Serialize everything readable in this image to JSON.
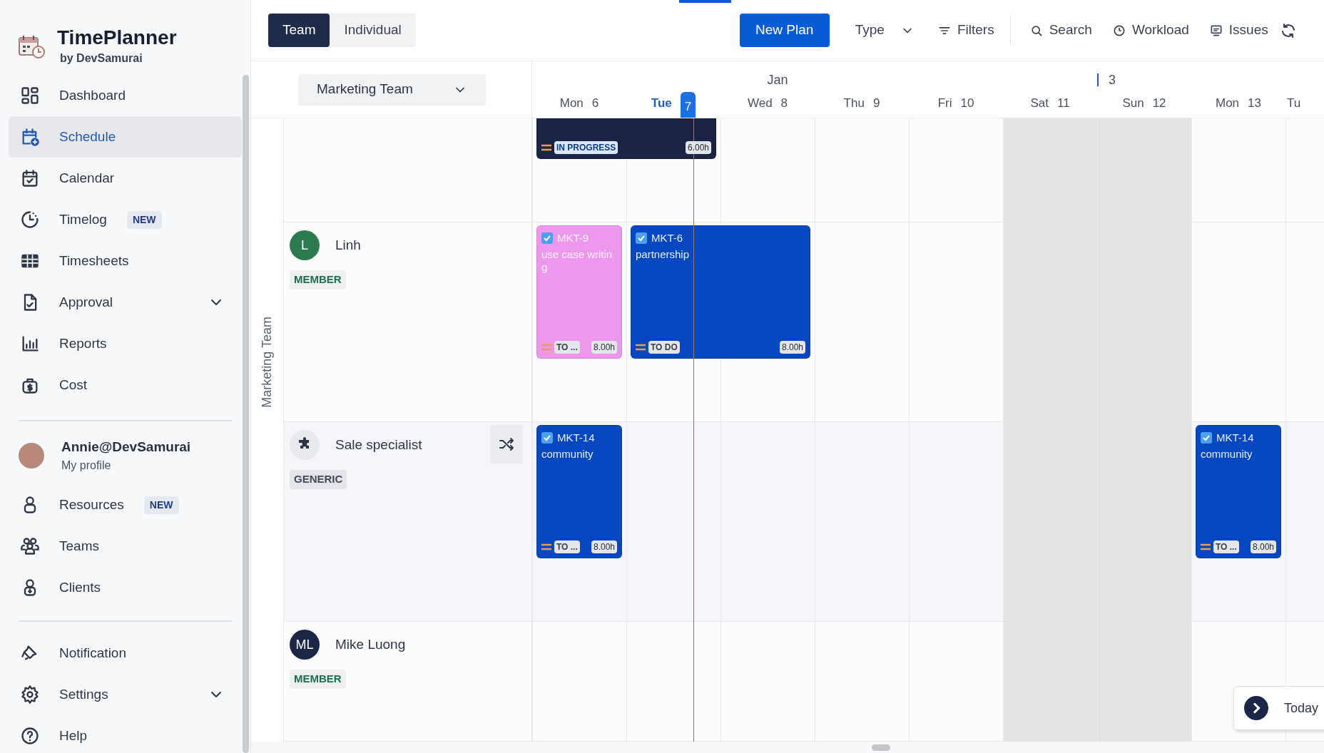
{
  "sidebar": {
    "brand": {
      "title": "TimePlanner",
      "subtitle": "by DevSamurai"
    },
    "nav": [
      {
        "label": "Dashboard",
        "selected": false,
        "kind": "link"
      },
      {
        "label": "Schedule",
        "selected": true,
        "kind": "link"
      },
      {
        "label": "Calendar",
        "selected": false,
        "kind": "link"
      },
      {
        "label": "Timelog",
        "selected": false,
        "kind": "link",
        "badge": "NEW"
      },
      {
        "label": "Timesheets",
        "selected": false,
        "kind": "link"
      },
      {
        "label": "Approval",
        "selected": false,
        "kind": "group"
      },
      {
        "label": "Reports",
        "selected": false,
        "kind": "link"
      },
      {
        "label": "Cost",
        "selected": false,
        "kind": "link"
      }
    ],
    "profile": {
      "name": "Annie@DevSamurai",
      "link": "My profile"
    },
    "people": [
      {
        "label": "Resources",
        "selected": false,
        "kind": "link",
        "badge": "NEW"
      },
      {
        "label": "Teams",
        "selected": false,
        "kind": "link"
      },
      {
        "label": "Clients",
        "selected": false,
        "kind": "link"
      }
    ],
    "footer": [
      {
        "label": "Notification",
        "selected": false,
        "kind": "link"
      },
      {
        "label": "Settings",
        "selected": false,
        "kind": "group"
      },
      {
        "label": "Help",
        "selected": false,
        "kind": "link"
      }
    ]
  },
  "toolbar": {
    "view_tabs": [
      {
        "label": "Team",
        "selected": true
      },
      {
        "label": "Individual",
        "selected": false
      }
    ],
    "new_button": "New Plan",
    "type_dropdown": "Type",
    "actions": [
      "Filters",
      "Search",
      "Workload",
      "Issues"
    ]
  },
  "schedule": {
    "team_select": "Marketing Team",
    "group_label": "Marketing Team",
    "month": "Jan",
    "week": "3",
    "days": [
      {
        "weekday": "Mon",
        "date": "6",
        "today": false,
        "weekend": false
      },
      {
        "weekday": "Tue",
        "date": "7",
        "today": true,
        "weekend": false
      },
      {
        "weekday": "Wed",
        "date": "8",
        "today": false,
        "weekend": false
      },
      {
        "weekday": "Thu",
        "date": "9",
        "today": false,
        "weekend": false
      },
      {
        "weekday": "Fri",
        "date": "10",
        "today": false,
        "weekend": false
      },
      {
        "weekday": "Sat",
        "date": "11",
        "today": false,
        "weekend": true
      },
      {
        "weekday": "Sun",
        "date": "12",
        "today": false,
        "weekend": true
      },
      {
        "weekday": "Mon",
        "date": "13",
        "today": false,
        "weekend": false
      },
      {
        "weekday": "Tu",
        "today": false,
        "weekend": false
      }
    ],
    "rows": [
      {
        "highlighted": false,
        "tasks": [
          {
            "status": "IN PROGRESS",
            "in_progress": true,
            "hours": "6.00h",
            "color": "#1b2444"
          }
        ]
      },
      {
        "highlighted": false,
        "member": {
          "kind": "member",
          "initials": "L",
          "name": "Linh",
          "role": "MEMBER",
          "color": "#2b7a50"
        },
        "tasks": [
          {
            "key": "MKT-9",
            "title": "use case writing",
            "status": "TO ...",
            "in_progress": false,
            "hours": "8.00h",
            "color": "#ee97ee"
          },
          {
            "key": "MKT-6",
            "title": "partnership",
            "status": "TO DO",
            "in_progress": false,
            "hours": "8.00h",
            "color": "#0747c2"
          }
        ]
      },
      {
        "highlighted": true,
        "member": {
          "kind": "generic",
          "name": "Sale specialist",
          "role": "GENERIC"
        },
        "tasks": [
          {
            "key": "MKT-14",
            "title": "community",
            "status": "TO ...",
            "in_progress": false,
            "hours": "8.00h",
            "color": "#0747c2"
          },
          {
            "key": "MKT-14",
            "title": "community",
            "status": "TO ...",
            "in_progress": false,
            "hours": "8.00h",
            "color": "#0747c2"
          }
        ]
      },
      {
        "highlighted": false,
        "member": {
          "kind": "member",
          "initials": "ML",
          "name": "Mike Luong",
          "role": "MEMBER",
          "color": "#1c2748"
        },
        "tasks": []
      }
    ]
  },
  "today_button": {
    "label": "Today"
  }
}
